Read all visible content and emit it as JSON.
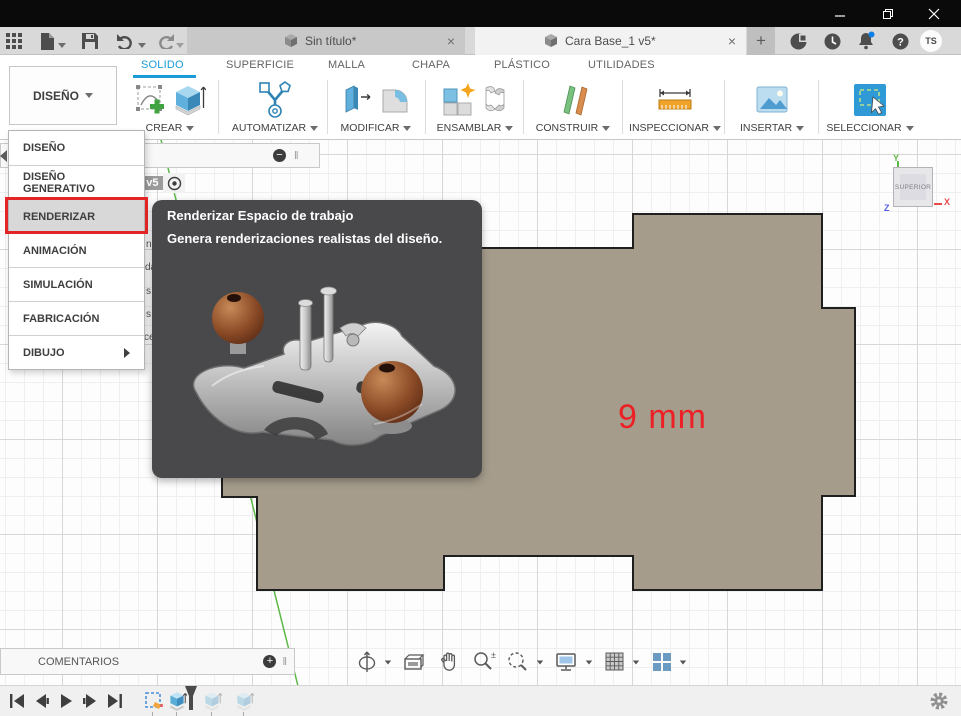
{
  "window": {
    "controls": [
      "minimize-icon",
      "restore-icon",
      "close-icon"
    ]
  },
  "app_toolbar": {
    "icons": [
      "app-grid-icon",
      "file-icon",
      "save-icon",
      "undo-icon",
      "redo-icon"
    ],
    "tabs": [
      {
        "label": "Sin título*",
        "active": false,
        "close": "×"
      },
      {
        "label": "Cara Base_1 v5*",
        "active": true,
        "close": "×"
      }
    ],
    "new_tab_label": "+",
    "right_icons": [
      "extensions-icon",
      "clock-icon",
      "notifications-icon",
      "help-icon"
    ],
    "avatar": "TS"
  },
  "ribbon": {
    "workspace_button": "DISEÑO",
    "tabs": [
      {
        "label": "SOLIDO",
        "active": true
      },
      {
        "label": "SUPERFICIE",
        "active": false
      },
      {
        "label": "MALLA",
        "active": false
      },
      {
        "label": "CHAPA",
        "active": false
      },
      {
        "label": "PLÁSTICO",
        "active": false
      },
      {
        "label": "UTILIDADES",
        "active": false
      }
    ],
    "groups": [
      "CREAR",
      "AUTOMATIZAR",
      "MODIFICAR",
      "ENSAMBLAR",
      "CONSTRUIR",
      "INSPECCIONAR",
      "INSERTAR",
      "SELECCIONAR"
    ]
  },
  "workspace_menu": {
    "items": [
      {
        "label": "DISEÑO"
      },
      {
        "label": "DISEÑO GENERATIVO"
      },
      {
        "label": "RENDERIZAR",
        "highlighted": true
      },
      {
        "label": "ANIMACIÓN"
      },
      {
        "label": "SIMULACIÓN"
      },
      {
        "label": "FABRICACIÓN"
      },
      {
        "label": "DIBUJO",
        "submenu": true
      }
    ]
  },
  "tooltip": {
    "title": "Renderizar Espacio de trabajo",
    "description": "Genera renderizaciones realistas del diseño.",
    "image": "router-plane-render"
  },
  "browser": {
    "doc_label": "_1 v5",
    "fragments": [
      "n",
      "da",
      "s",
      "s",
      "ce"
    ]
  },
  "canvas": {
    "dimension": "9 mm",
    "viewcube_face": "SUPERIOR",
    "axis_x": "X",
    "axis_y": "Y",
    "axis_z": "Z"
  },
  "comments_panel": {
    "label": "COMENTARIOS"
  },
  "nav_toolbar_icons": [
    "orbit-icon",
    "look-at-icon",
    "pan-icon",
    "zoom-icon",
    "zoom-window-icon",
    "display-settings-icon",
    "grid-settings-icon",
    "viewports-icon"
  ],
  "timeline": {
    "playback_icons": [
      "skip-start-icon",
      "step-back-icon",
      "play-icon",
      "step-forward-icon",
      "skip-end-icon"
    ],
    "feature_icons": [
      "sketch-icon",
      "extrude-icon",
      "extrude-icon-ghost",
      "extrude-icon-ghost"
    ],
    "settings_icon": "gear-icon"
  },
  "colors": {
    "accent_blue": "#1a9bd7",
    "highlight_red": "#e42525",
    "dimension_red": "#ec2025",
    "shape_fill": "#a59c8b",
    "shape_stroke": "#1f1f1f",
    "axis_green": "#5cb848",
    "tooltip_bg": "#49494b",
    "titlebar_bg": "#0a0a0a"
  }
}
